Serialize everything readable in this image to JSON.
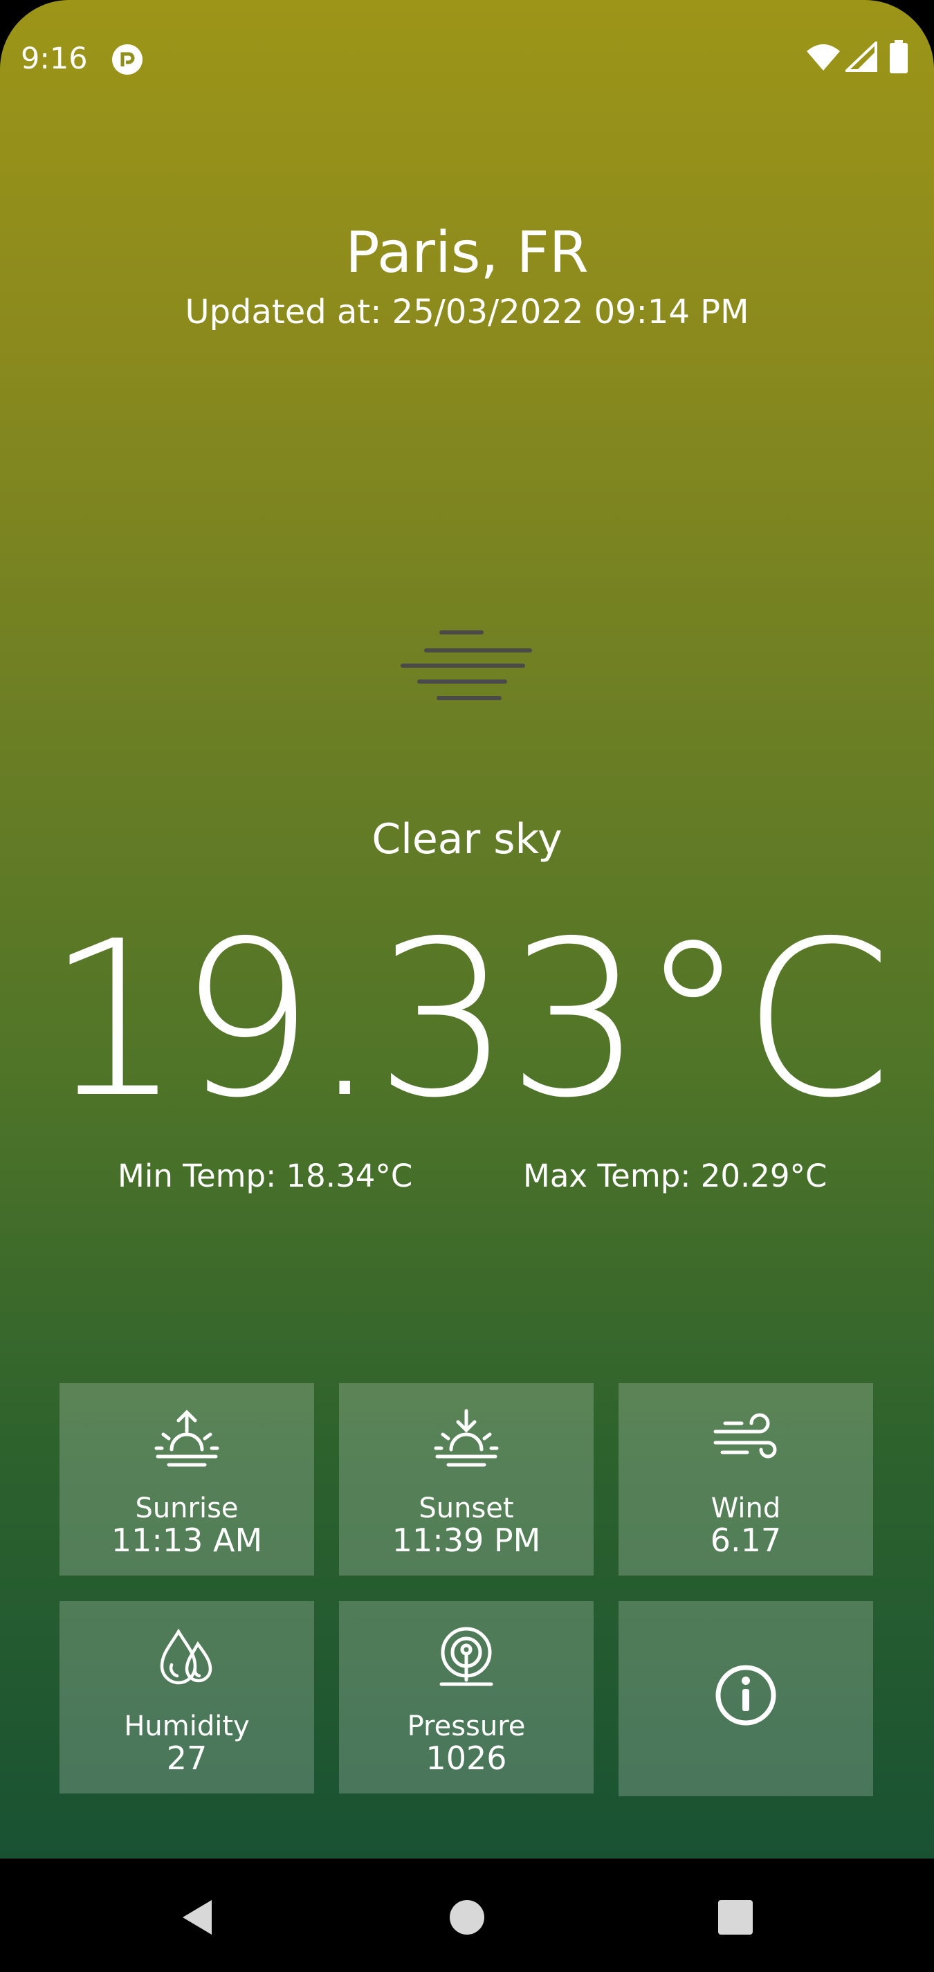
{
  "status_bar": {
    "time": "9:16",
    "icons": [
      "app-notification-icon",
      "wifi-icon",
      "cellular-signal-icon",
      "battery-icon"
    ]
  },
  "location": {
    "city": "Paris, FR"
  },
  "updated": "Updated at: 25/03/2022 09:14 PM",
  "condition": {
    "icon": "haze-icon",
    "description": "Clear sky"
  },
  "temperature": {
    "current": "19.33°C",
    "min": "Min Temp: 18.34°C",
    "max": "Max Temp: 20.29°C"
  },
  "tiles": {
    "sunrise": {
      "label": "Sunrise",
      "value": "11:13 AM",
      "icon": "sunrise-icon"
    },
    "sunset": {
      "label": "Sunset",
      "value": "11:39 PM",
      "icon": "sunset-icon"
    },
    "wind": {
      "label": "Wind",
      "value": "6.17",
      "icon": "wind-icon"
    },
    "humidity": {
      "label": "Humidity",
      "value": "27",
      "icon": "humidity-icon"
    },
    "pressure": {
      "label": "Pressure",
      "value": "1026",
      "icon": "pressure-icon"
    },
    "about": {
      "icon": "info-icon"
    }
  },
  "navigation": {
    "buttons": [
      "back-icon",
      "home-icon",
      "recents-icon"
    ]
  },
  "colors": {
    "gradient_top": "#9c9518",
    "gradient_bottom": "#195233",
    "tile_overlay": "rgba(255,255,255,0.2)"
  }
}
